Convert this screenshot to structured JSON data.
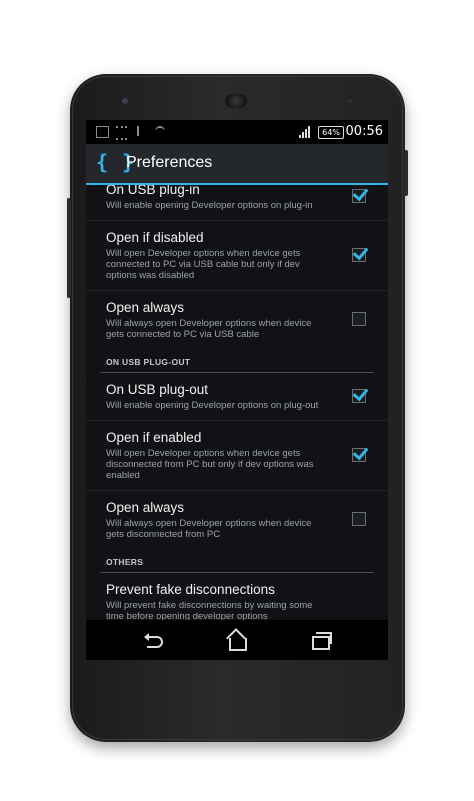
{
  "status_bar": {
    "icons": [
      "image-icon",
      "usb-debug-icon",
      "usb-icon",
      "sync-icon"
    ],
    "signal": "signal-icon",
    "battery_label": "64%",
    "time": "00:56"
  },
  "action_bar": {
    "logo": "{ }",
    "title": "Preferences",
    "accent_color": "#33b5e5"
  },
  "preferences": {
    "plugin": {
      "on_usb_plugin": {
        "title": "On USB plug-in",
        "summary": "Will enable opening Developer options on plug-in",
        "checked": true
      },
      "open_if_disabled": {
        "title": "Open if disabled",
        "summary": "Will open Developer options when device gets connected to PC via USB cable but only if dev options was disabled",
        "checked": true
      },
      "open_always": {
        "title": "Open always",
        "summary": "Will always open Developer options when device gets connected to PC via USB cable",
        "checked": false
      }
    },
    "plugout_header": "ON USB PLUG-OUT",
    "plugout": {
      "on_usb_plugout": {
        "title": "On USB plug-out",
        "summary": "Will enable opening Developer options on plug-out",
        "checked": true
      },
      "open_if_enabled": {
        "title": "Open if enabled",
        "summary": "Will open Developer options when device gets disconnected from PC but only if dev options was enabled",
        "checked": true
      },
      "open_always": {
        "title": "Open always",
        "summary": "Will always open Developer options when device gets disconnected from PC",
        "checked": false
      }
    },
    "others_header": "OTHERS",
    "others": {
      "prevent_fake": {
        "title": "Prevent fake disconnections",
        "summary": "Will prevent fake disconnections by waiting some time before opening developer options"
      }
    }
  },
  "nav_bar": {
    "back": "back-icon",
    "home": "home-icon",
    "recents": "recent-apps-icon"
  }
}
